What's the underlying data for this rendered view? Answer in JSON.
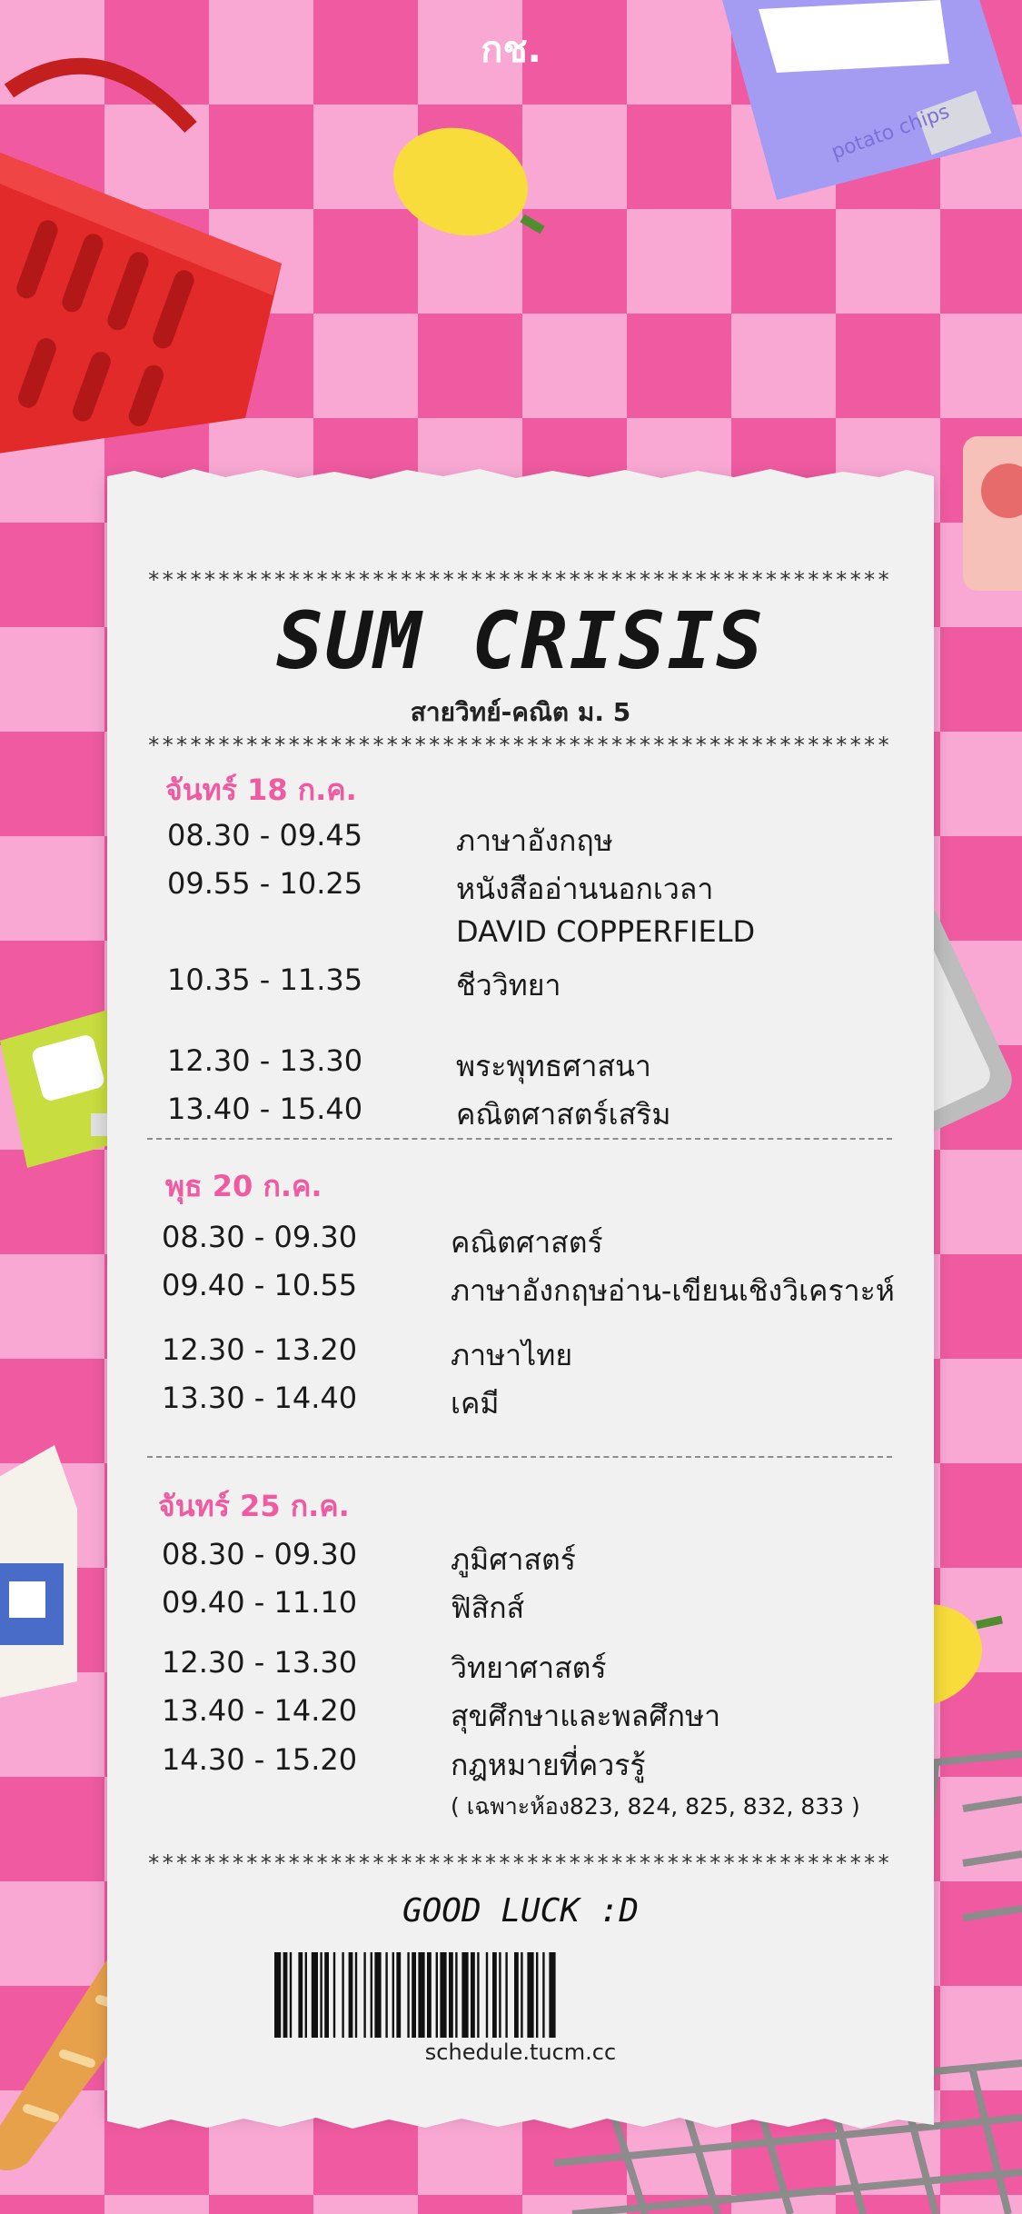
{
  "brand": "กช.",
  "receipt": {
    "stars": "*************************************************************************",
    "title": "SUM CRISIS",
    "subtitle": "สายวิทย์-คณิต ม. 5",
    "days": [
      {
        "label": "จันทร์ 18 ก.ค.",
        "rows": [
          {
            "time": "08.30 - 09.45",
            "subject": "ภาษาอังกฤษ"
          },
          {
            "time": "09.55 - 10.25",
            "subject": "หนังสืออ่านนอกเวลา"
          },
          {
            "time": "",
            "subject": "DAVID COPPERFIELD"
          },
          {
            "time": "10.35 - 11.35",
            "subject": "ชีววิทยา"
          },
          {
            "time": "12.30 - 13.30",
            "subject": "พระพุทธศาสนา"
          },
          {
            "time": "13.40 - 15.40",
            "subject": "คณิตศาสตร์เสริม"
          }
        ]
      },
      {
        "label": "พุธ 20 ก.ค.",
        "rows": [
          {
            "time": "08.30 - 09.30",
            "subject": "คณิตศาสตร์"
          },
          {
            "time": "09.40 - 10.55",
            "subject": "ภาษาอังกฤษอ่าน-เขียนเชิงวิเคราะห์"
          },
          {
            "time": "12.30 - 13.20",
            "subject": "ภาษาไทย"
          },
          {
            "time": "13.30 - 14.40",
            "subject": "เคมี"
          }
        ]
      },
      {
        "label": "จันทร์ 25 ก.ค.",
        "rows": [
          {
            "time": "08.30 - 09.30",
            "subject": "ภูมิศาสตร์"
          },
          {
            "time": "09.40 - 11.10",
            "subject": "ฟิสิกส์"
          },
          {
            "time": "12.30 - 13.30",
            "subject": "วิทยาศาสตร์"
          },
          {
            "time": "13.40 - 14.20",
            "subject": "สุขศึกษาและพลศึกษา"
          },
          {
            "time": "14.30 - 15.20",
            "subject": "กฎหมายที่ควรรู้"
          }
        ],
        "note": "( เฉพาะห้อง823, 824, 825, 832, 833 )"
      }
    ],
    "footer": "GOOD LUCK :D",
    "url": "schedule.tucm.cc"
  },
  "decorations": {
    "chips_label": "potato chips",
    "colors": {
      "pink_light": "#f8a8d3",
      "pink_dark": "#ef5aa0",
      "paper": "#f1f1f1",
      "accent_text": "#ef5aa0"
    }
  }
}
